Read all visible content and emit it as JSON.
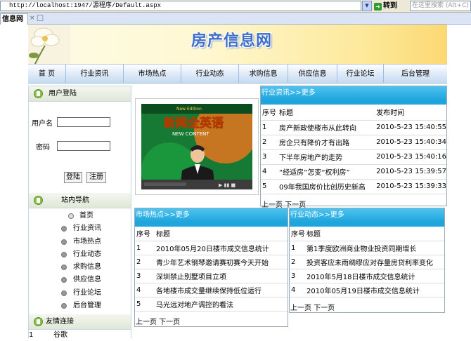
{
  "browser": {
    "address": "http://localhost:1947/源程序/Default.aspx",
    "go_label": "转到",
    "search_placeholder": "在这里搜索 (Alt+C)",
    "tab_title": "信息网"
  },
  "site": {
    "title": "房产信息网"
  },
  "nav": {
    "items": [
      "首 页",
      "行业资讯",
      "市场热点",
      "行业动态",
      "求购信息",
      "供应信息",
      "行业论坛",
      "后台管理"
    ]
  },
  "login": {
    "heading": "用户登陆",
    "username_label": "用户名",
    "password_label": "密码",
    "login_button": "登陆",
    "register_button": "注册"
  },
  "site_nav": {
    "heading": "站内导航",
    "items": [
      "首页",
      "行业资讯",
      "市场热点",
      "行业动态",
      "求购信息",
      "供应信息",
      "行业论坛",
      "后台管理"
    ]
  },
  "friend_links": {
    "heading": "友情连接",
    "rows": [
      {
        "no": "1",
        "name": "谷歌"
      }
    ]
  },
  "industry_news": {
    "heading": "行业资讯>>更多",
    "cols": [
      "序号",
      "标题",
      "发布时间"
    ],
    "rows": [
      {
        "no": "1",
        "title": "房产新政使楼市从此转向",
        "time": "2010-5-23 15:40:55"
      },
      {
        "no": "2",
        "title": "房企只有降价才有出路",
        "time": "2010-5-23 15:40:34"
      },
      {
        "no": "3",
        "title": "下半年房地产的走势",
        "time": "2010-5-23 15:40:16"
      },
      {
        "no": "4",
        "title": "“经适房”怎变“权利房”",
        "time": "2010-5-23 15:39:57"
      },
      {
        "no": "5",
        "title": "09年我国房价比创历史新高",
        "time": "2010-5-23 15:39:33"
      }
    ],
    "pager": "上一页 下一页"
  },
  "market_hot": {
    "heading": "市场热点>>更多",
    "cols": [
      "序号",
      "标题"
    ],
    "rows": [
      {
        "no": "1",
        "title": "2010年05月20日楼市成交信息统计"
      },
      {
        "no": "2",
        "title": "青少年艺术钢琴邀请赛初赛今天开始"
      },
      {
        "no": "3",
        "title": "深圳禁止别墅项目立项"
      },
      {
        "no": "4",
        "title": "各地楼市成交量继续保持低位运行"
      },
      {
        "no": "5",
        "title": "马光远对地产调控的看法"
      }
    ],
    "pager": "上一页 下一页"
  },
  "industry_dyn": {
    "heading": "行业动态>>更多",
    "cols": [
      "序号",
      "标题"
    ],
    "rows": [
      {
        "no": "1",
        "title": "第1季度欧洲商业物业投资同期增长"
      },
      {
        "no": "2",
        "title": "投资客应未雨绸缪应对存量房贷利率变化"
      },
      {
        "no": "3",
        "title": "2010年5月18日楼市成交信息统计"
      },
      {
        "no": "4",
        "title": "2010年05月19日楼市成交信息统计"
      }
    ],
    "pager": "上一页 下一页"
  },
  "video": {
    "caption": "新闻全英语",
    "sub": "NEW CONTENT"
  }
}
